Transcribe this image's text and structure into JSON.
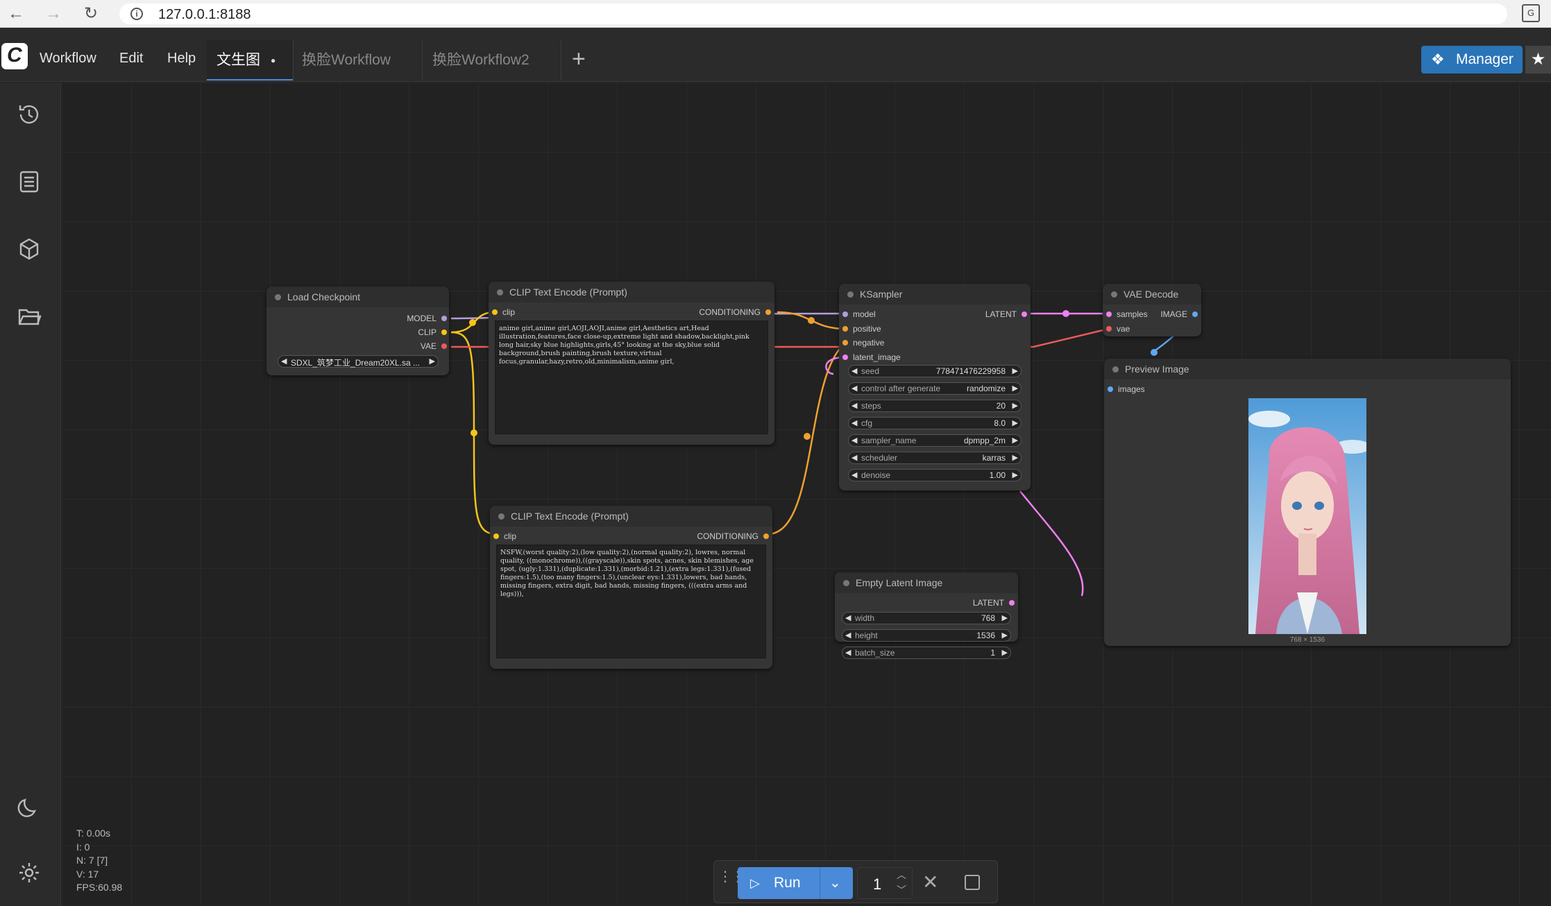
{
  "browser": {
    "url": "127.0.0.1:8188"
  },
  "menubar": {
    "workflow": "Workflow",
    "edit": "Edit",
    "help": "Help"
  },
  "tabs": [
    {
      "label": "文生图",
      "dirty": "●"
    },
    {
      "label": "换脸Workflow"
    },
    {
      "label": "换脸Workflow2"
    }
  ],
  "manager_label": "Manager",
  "nodes": {
    "load_checkpoint": {
      "title": "Load Checkpoint",
      "out_model": "MODEL",
      "out_clip": "CLIP",
      "out_vae": "VAE",
      "ckpt": "SDXL_筑梦工业_Dream20XL.sa ..."
    },
    "clip_pos": {
      "title": "CLIP Text Encode (Prompt)",
      "in_clip": "clip",
      "out": "CONDITIONING",
      "text": "anime girl,anime girl,AOJI,AOJI,anime girl,Aesthetics art,Head illustration,features,face close-up,extreme light and shadow,backlight,pink long hair,sky blue highlights,girls,45° looking at the sky,blue solid background,brush painting,brush texture,virtual focus,granular,hazy,retro,old,minimalism,anime girl,"
    },
    "clip_neg": {
      "title": "CLIP Text Encode (Prompt)",
      "in_clip": "clip",
      "out": "CONDITIONING",
      "text": "NSFW,(worst quality:2),(low quality:2),(normal quality:2), lowres, normal quality, ((monochrome)),((grayscale)),skin spots, acnes, skin blemishes, age spot, (ugly:1.331),(duplicate:1.331),(morbid:1.21),(extra legs:1.331),(fused fingers:1.5),(too many fingers:1.5),(unclear eys:1.331),lowers, bad hands, missing fingers, extra digit, bad hands, missing fingers, (((extra arms and legs))),"
    },
    "ksampler": {
      "title": "KSampler",
      "in_model": "model",
      "in_positive": "positive",
      "in_negative": "negative",
      "in_latent": "latent_image",
      "out": "LATENT",
      "widgets": [
        {
          "label": "seed",
          "value": "778471476229958"
        },
        {
          "label": "control after generate",
          "value": "randomize"
        },
        {
          "label": "steps",
          "value": "20"
        },
        {
          "label": "cfg",
          "value": "8.0"
        },
        {
          "label": "sampler_name",
          "value": "dpmpp_2m"
        },
        {
          "label": "scheduler",
          "value": "karras"
        },
        {
          "label": "denoise",
          "value": "1.00"
        }
      ]
    },
    "vae_decode": {
      "title": "VAE Decode",
      "in_samples": "samples",
      "in_vae": "vae",
      "out": "IMAGE"
    },
    "preview": {
      "title": "Preview Image",
      "in_images": "images",
      "size": "768 × 1536"
    },
    "empty_latent": {
      "title": "Empty Latent Image",
      "out": "LATENT",
      "widgets": [
        {
          "label": "width",
          "value": "768"
        },
        {
          "label": "height",
          "value": "1536"
        },
        {
          "label": "batch_size",
          "value": "1"
        }
      ]
    }
  },
  "stats": {
    "t": "T: 0.00s",
    "i": "I: 0",
    "n": "N: 7 [7]",
    "v": "V: 17",
    "fps": "FPS:60.98"
  },
  "runbar": {
    "run_label": "Run",
    "count": "1"
  },
  "colors": {
    "accent": "#4a8ad8",
    "manager": "#2a74b8",
    "clip_wire": "#f5c518",
    "cond_wire": "#f0a030",
    "vae_wire": "#ee5a5a",
    "latent_wire": "#f080f0",
    "image_wire": "#60a8f0",
    "model_wire": "#b39ddb"
  }
}
